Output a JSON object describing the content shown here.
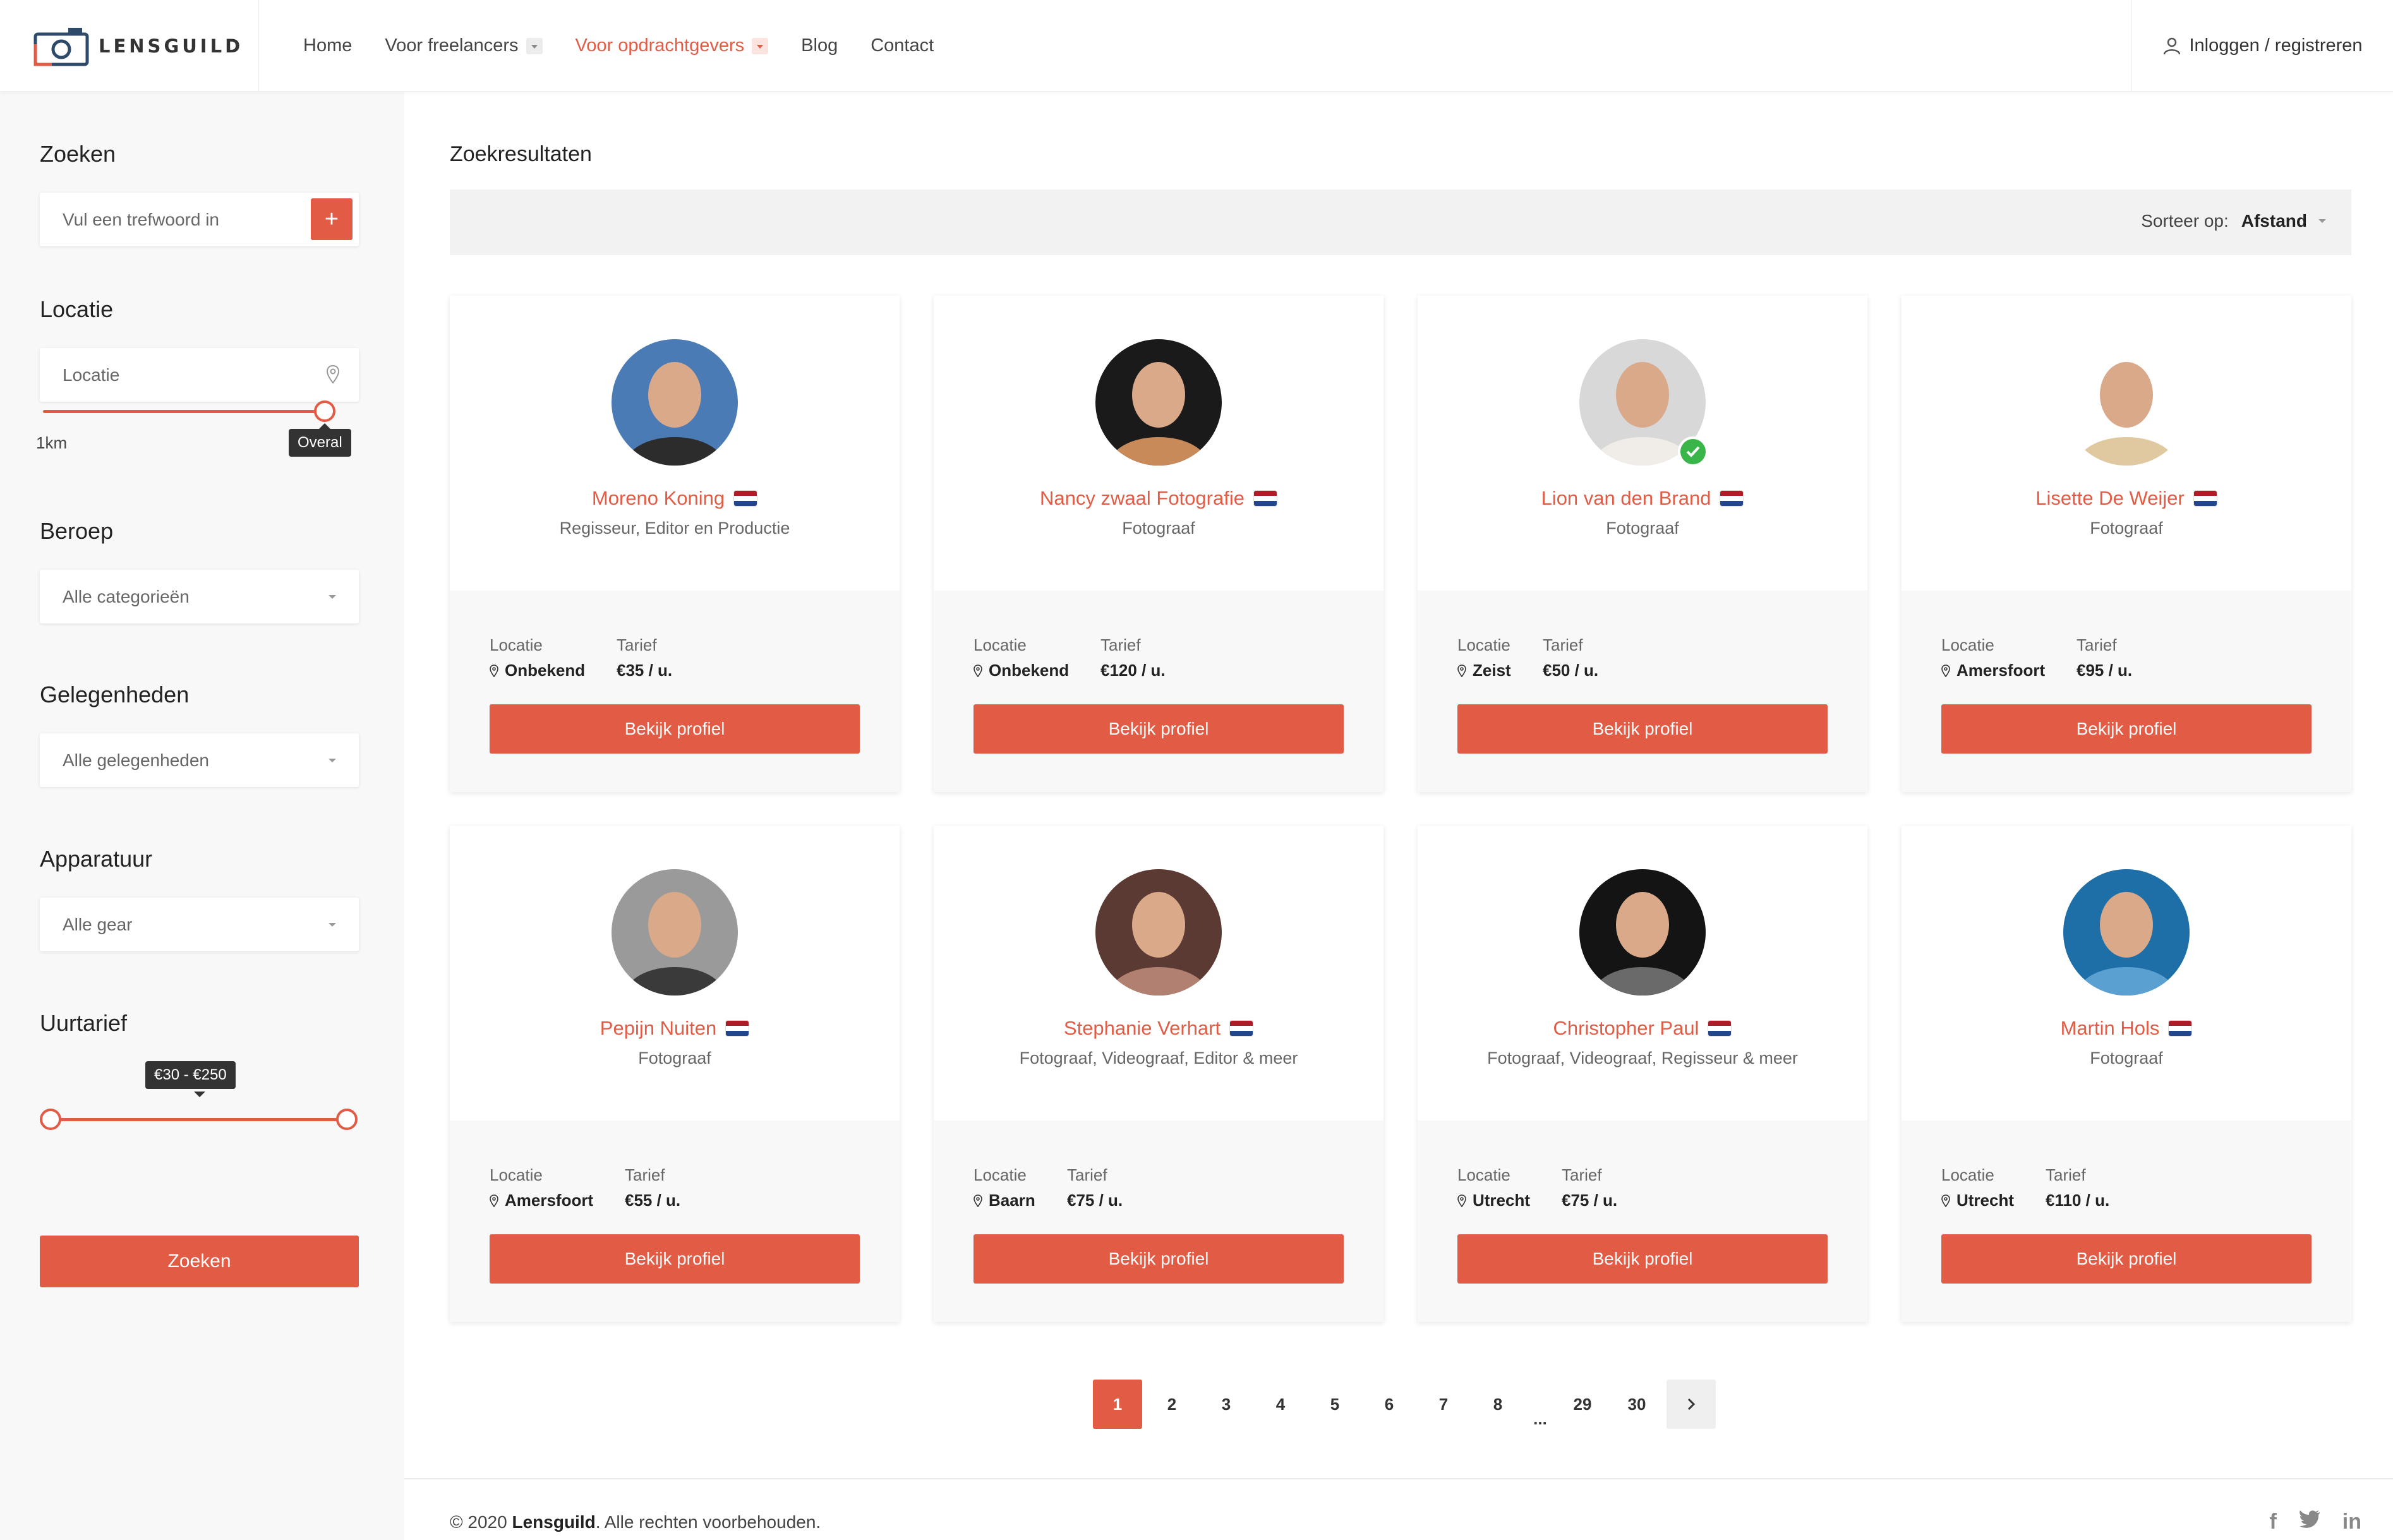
{
  "header": {
    "logo_text": "LENSGUILD",
    "nav": [
      {
        "label": "Home",
        "dropdown": false,
        "active": false
      },
      {
        "label": "Voor freelancers",
        "dropdown": true,
        "active": false
      },
      {
        "label": "Voor opdrachtgevers",
        "dropdown": true,
        "active": true
      },
      {
        "label": "Blog",
        "dropdown": false,
        "active": false
      },
      {
        "label": "Contact",
        "dropdown": false,
        "active": false
      }
    ],
    "login_label": "Inloggen / registreren"
  },
  "sidebar": {
    "search": {
      "label": "Zoeken",
      "placeholder": "Vul een trefwoord in",
      "add_button": "+"
    },
    "location": {
      "label": "Locatie",
      "placeholder": "Locatie",
      "radius_min": "1km",
      "radius_value": "Overal",
      "radius_fraction": 1.0
    },
    "profession": {
      "label": "Beroep",
      "selected": "Alle categorieën"
    },
    "occasions": {
      "label": "Gelegenheden",
      "selected": "Alle gelegenheden"
    },
    "gear": {
      "label": "Apparatuur",
      "selected": "Alle gear"
    },
    "rate": {
      "label": "Uurtarief",
      "range_text": "€30 - €250",
      "low_fraction": 0.0,
      "high_fraction": 1.0
    },
    "submit_label": "Zoeken"
  },
  "main": {
    "title": "Zoekresultaten",
    "sort_label": "Sorteer op:",
    "sort_value": "Afstand",
    "location_label": "Locatie",
    "rate_label": "Tarief",
    "button_label": "Bekijk profiel",
    "cards": [
      {
        "name": "Moreno Koning",
        "role": "Regisseur, Editor en Productie",
        "location": "Onbekend",
        "rate": "€35 / u.",
        "verified": false,
        "avatar_colors": [
          "#4a7bb5",
          "#2c2c2c"
        ]
      },
      {
        "name": "Nancy zwaal Fotografie",
        "role": "Fotograaf",
        "location": "Onbekend",
        "rate": "€120 / u.",
        "verified": false,
        "avatar_colors": [
          "#1a1a1a",
          "#c98a5a"
        ]
      },
      {
        "name": "Lion van den Brand",
        "role": "Fotograaf",
        "location": "Zeist",
        "rate": "€50 / u.",
        "verified": true,
        "avatar_colors": [
          "#d8d8d8",
          "#f0ece8"
        ]
      },
      {
        "name": "Lisette De Weijer",
        "role": "Fotograaf",
        "location": "Amersfoort",
        "rate": "€95 / u.",
        "verified": false,
        "avatar_colors": [
          "#ffffff",
          "#e0c9a0"
        ]
      },
      {
        "name": "Pepijn Nuiten",
        "role": "Fotograaf",
        "location": "Amersfoort",
        "rate": "€55 / u.",
        "verified": false,
        "avatar_colors": [
          "#9a9a9a",
          "#3a3a3a"
        ]
      },
      {
        "name": "Stephanie Verhart",
        "role": "Fotograaf, Videograaf, Editor & meer",
        "location": "Baarn",
        "rate": "€75 / u.",
        "verified": false,
        "avatar_colors": [
          "#5a3a32",
          "#b28070"
        ]
      },
      {
        "name": "Christopher Paul",
        "role": "Fotograaf, Videograaf, Regisseur & meer",
        "location": "Utrecht",
        "rate": "€75 / u.",
        "verified": false,
        "avatar_colors": [
          "#141414",
          "#6a6a6a"
        ]
      },
      {
        "name": "Martin Hols",
        "role": "Fotograaf",
        "location": "Utrecht",
        "rate": "€110 / u.",
        "verified": false,
        "avatar_colors": [
          "#1e6fa8",
          "#5aa0d0"
        ]
      }
    ]
  },
  "pagination": {
    "pages": [
      "1",
      "2",
      "3",
      "4",
      "5",
      "6",
      "7",
      "8",
      "...",
      "29",
      "30"
    ],
    "active": "1",
    "next_icon": "chevron-right-icon"
  },
  "footer": {
    "year_text": "© 2020",
    "brand": "Lensguild",
    "rights_text": ". Alle rechten voorbehouden.",
    "social": [
      "f",
      "twitter",
      "in"
    ]
  },
  "colors": {
    "accent": "#e25c45",
    "sidebar_bg": "#f8f8f8",
    "flag_red": "#ae1c28",
    "flag_white": "#ffffff",
    "flag_blue": "#21468b",
    "verified": "#3ab54a"
  }
}
